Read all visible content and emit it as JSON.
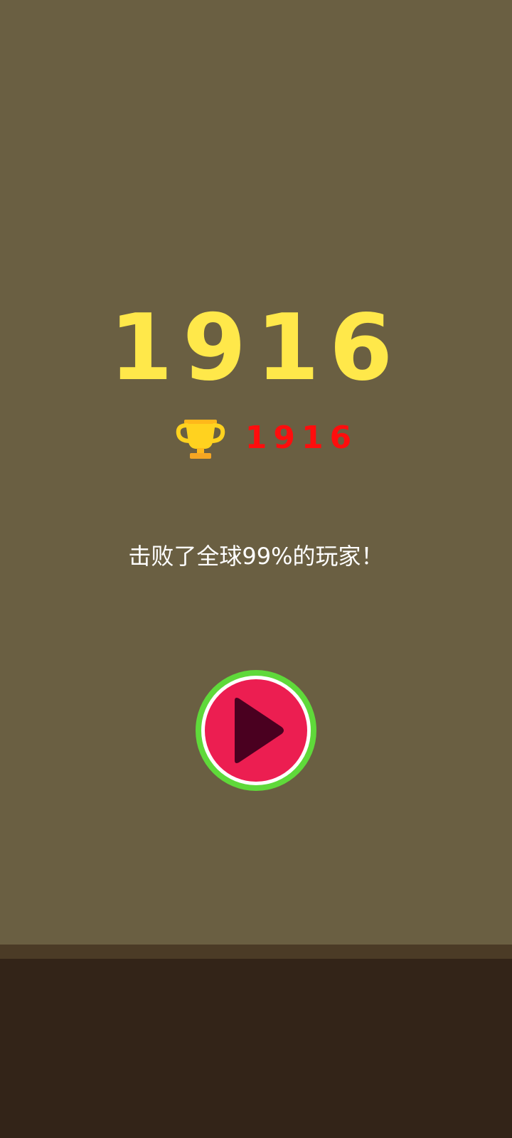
{
  "score": {
    "current": "1916"
  },
  "best": {
    "value": "1916",
    "icon": "trophy-icon"
  },
  "message": {
    "text": "击败了全球99%的玩家！"
  },
  "play": {
    "icon": "play-icon"
  },
  "colors": {
    "background": "#6a5f42",
    "score": "#ffe84a",
    "best": "#ff0d0d",
    "button_ring": "#5fd93a",
    "button_fill": "#ec1e51",
    "play_triangle": "#4a0020",
    "ground": "#332418"
  }
}
